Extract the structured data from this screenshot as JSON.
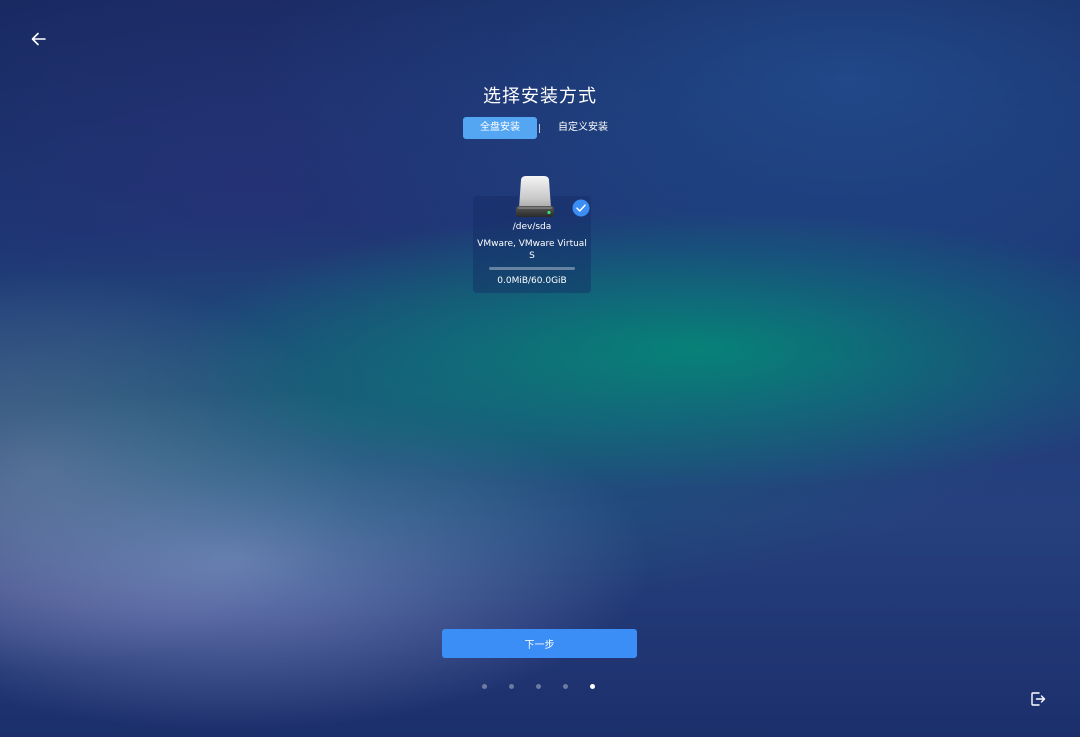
{
  "header": {
    "title": "选择安装方式",
    "back_icon": "arrow-left-icon"
  },
  "tabs": [
    {
      "label": "全盘安装",
      "active": true
    },
    {
      "label": "自定义安装",
      "active": false
    }
  ],
  "disk": {
    "icon": "hard-drive-icon",
    "selected_icon": "check-circle-icon",
    "path": "/dev/sda",
    "model": "VMware, VMware Virtual S",
    "size_text": "0.0MiB/60.0GiB",
    "used_fraction": 0.0
  },
  "footer": {
    "next_label": "下一步",
    "total_steps": 5,
    "current_step": 5,
    "exit_icon": "exit-icon"
  },
  "colors": {
    "accent": "#3a8ef6",
    "tab_active": "#54a6f3",
    "check": "#3a8ef6"
  }
}
